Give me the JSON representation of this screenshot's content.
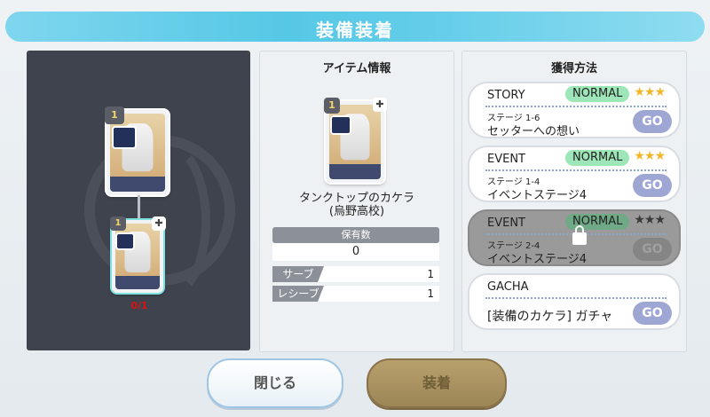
{
  "title": "装備装着",
  "left_panel": {
    "count_text": "0/1",
    "card_large": {
      "rank": "1"
    },
    "card_small": {
      "rank": "1"
    }
  },
  "item_info": {
    "heading": "アイテム情報",
    "name_line1": "タンクトップのカケラ",
    "name_line2": "(烏野高校)",
    "owned_label": "保有数",
    "owned_value": "0",
    "stats": [
      {
        "label": "サーブ",
        "value": "1"
      },
      {
        "label": "レシーブ",
        "value": "1"
      }
    ]
  },
  "acquire": {
    "heading": "獲得方法",
    "sources": [
      {
        "kind": "STORY",
        "badge": "NORMAL",
        "stars": "★★★",
        "stage": "ステージ 1-6",
        "desc": "セッターへの想い",
        "go": "GO",
        "locked": false
      },
      {
        "kind": "EVENT",
        "badge": "NORMAL",
        "stars": "★★★",
        "stage": "ステージ 1-4",
        "desc": "イベントステージ4",
        "go": "GO",
        "locked": false
      },
      {
        "kind": "EVENT",
        "badge": "NORMAL",
        "stars": "★★★",
        "stage": "ステージ 2-4",
        "desc": "イベントステージ4",
        "go": "GO",
        "locked": true
      },
      {
        "kind": "GACHA",
        "desc": "[装備のカケラ] ガチャ",
        "go": "GO",
        "locked": false
      }
    ]
  },
  "buttons": {
    "close": "閉じる",
    "equip": "装着"
  },
  "colors": {
    "title_bar": "#55c8e6",
    "go": "#9ea7d4",
    "normal_badge": "#9de6b7",
    "star": "#f0b72a"
  }
}
